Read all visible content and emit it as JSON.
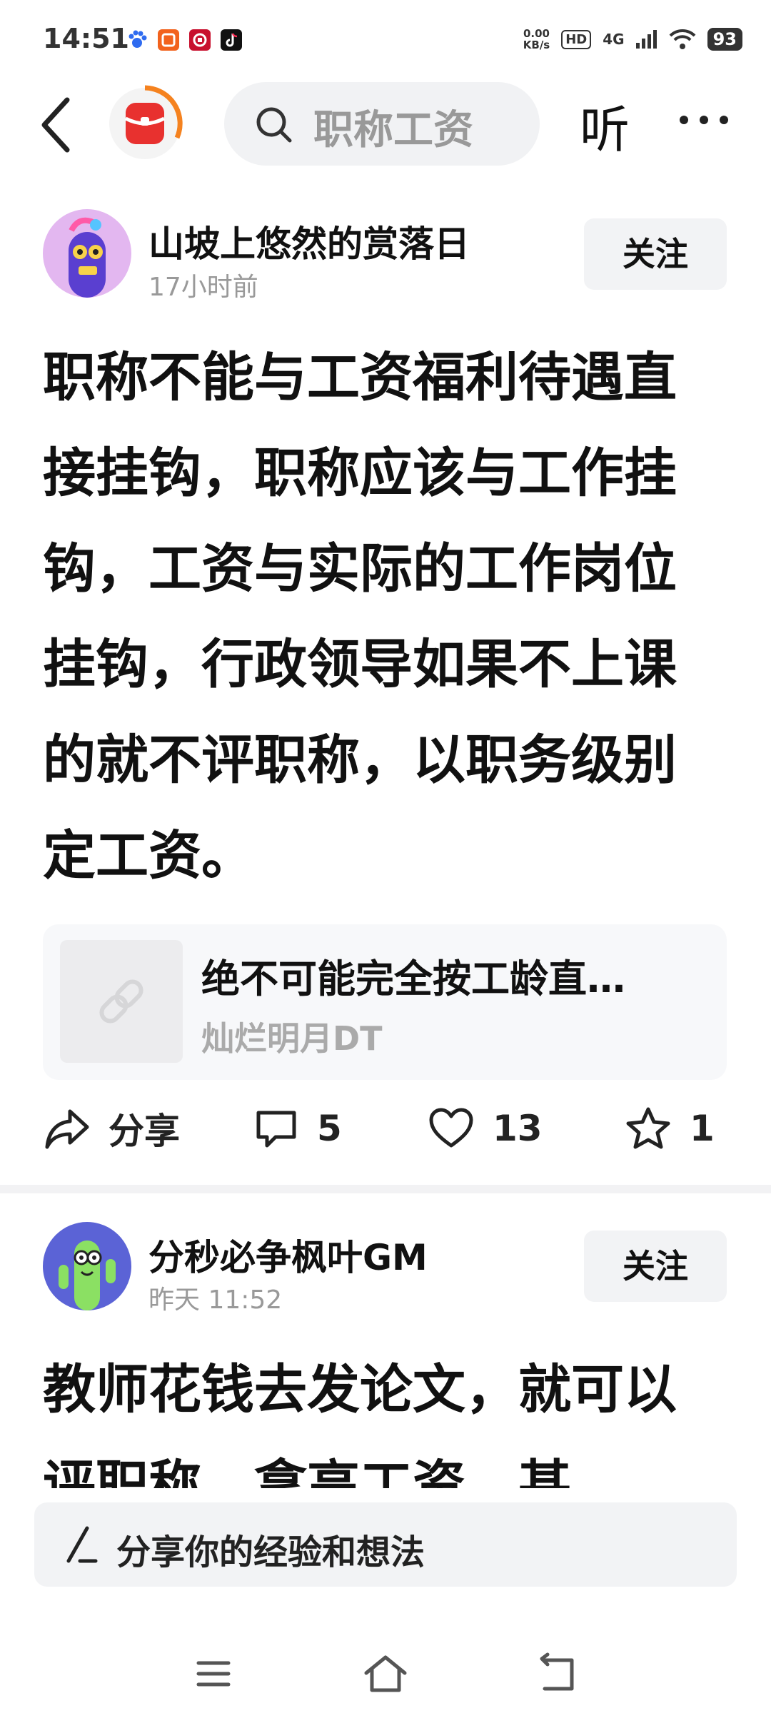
{
  "status_bar": {
    "time": "14:51",
    "net_speed_value": "0.00",
    "net_speed_unit": "KB/s",
    "hd": "HD",
    "network": "4G",
    "battery": "93",
    "app_icons": [
      {
        "name": "baidu-paw-icon",
        "color": "#2f6bf0"
      },
      {
        "name": "shop-icon",
        "color": "#f2621d"
      },
      {
        "name": "bank-icon",
        "color": "#c8102e"
      },
      {
        "name": "tiktok-icon",
        "color": "#111111"
      }
    ]
  },
  "nav": {
    "search_placeholder": "职称工资",
    "listen_label": "听"
  },
  "posts": [
    {
      "author": "山坡上悠然的赏落日",
      "time": "17小时前",
      "follow_label": "关注",
      "body": "职称不能与工资福利待遇直接挂钩，职称应该与工作挂钩，工资与实际的工作岗位挂钩，行政领导如果不上课的就不评职称，以职务级别定工资。",
      "quote": {
        "title": "绝不可能完全按工龄直…",
        "author": "灿烂明月DT"
      },
      "actions": {
        "share_label": "分享",
        "comments": "5",
        "likes": "13",
        "favorites": "1"
      }
    },
    {
      "author": "分秒必争枫叶GM",
      "time": "昨天  11:52",
      "follow_label": "关注",
      "body": "教师花钱去发论文，就可以评职称，拿高工资，甚"
    }
  ],
  "composer": {
    "placeholder": "分享你的经验和想法"
  },
  "colors": {
    "accent_orange": "#f5821f",
    "brand_red": "#e8312f",
    "follow_bg": "#f2f3f5",
    "muted_text": "#999999"
  }
}
